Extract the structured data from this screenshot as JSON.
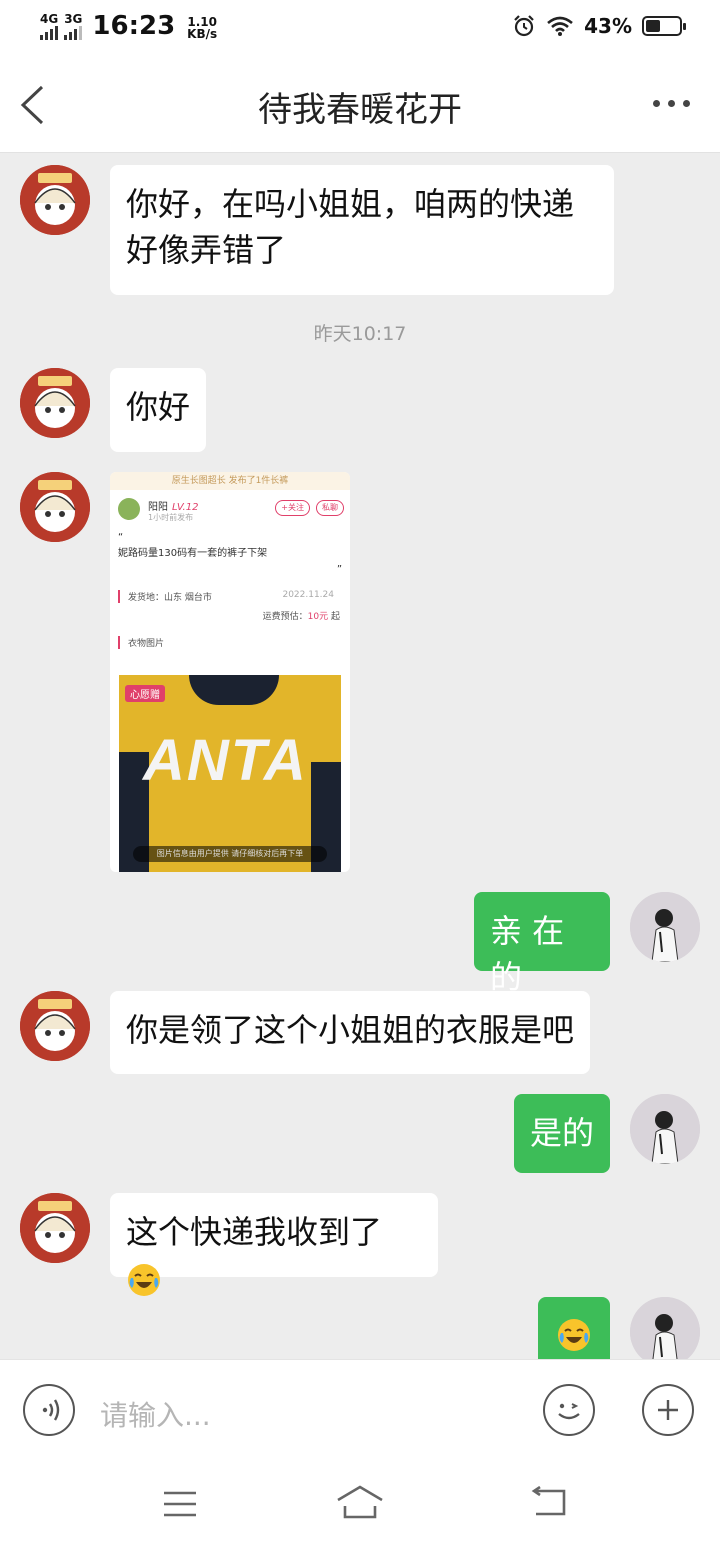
{
  "status_bar": {
    "network1": "4G",
    "network2": "3G",
    "time": "16:23",
    "speed_value": "1.10",
    "speed_unit": "KB/s",
    "battery": "43%",
    "battery_fraction": 0.43
  },
  "header": {
    "title": "待我春暖花开"
  },
  "messages": [
    {
      "sender": "other",
      "text_line1": "你好，在吗小姐姐，咱两的快递",
      "text_line2": "好像弄错了"
    },
    {
      "type": "timestamp",
      "text": "昨天10:17"
    },
    {
      "sender": "other",
      "text": "你好"
    },
    {
      "sender": "other",
      "type": "image"
    },
    {
      "sender": "me",
      "text": "亲 在的"
    },
    {
      "sender": "other",
      "text": "你是领了这个小姐姐的衣服是吧"
    },
    {
      "sender": "me",
      "text": "是的"
    },
    {
      "sender": "other",
      "text": "这个快递我收到了",
      "emoji": "crying-laughing-emoji"
    },
    {
      "sender": "me",
      "emoji": "crying-laughing-emoji"
    }
  ],
  "shared_image": {
    "top_note": "原生长图超长 发布了1件长裤",
    "user_name": "阳阳",
    "user_level": "LV.12",
    "post_time": "1小时前发布",
    "follow_label": "+关注",
    "private_msg_label": "私聊",
    "quote_text": "妮路码量130码有一套的裤子下架",
    "ship_from_label": "发货地：山东 烟台市",
    "ship_date": "2022.11.24",
    "fee_label": "运费预估：",
    "fee_value": "10元",
    "fee_suffix": "起",
    "photos_label": "衣物图片",
    "photo_tag": "心愿赠",
    "photo_brand": "ANTA",
    "photo_caption": "图片信息由用户提供 请仔细核对后再下单"
  },
  "input": {
    "placeholder": "请输入..."
  },
  "colors": {
    "my_bubble": "#3dbd58",
    "their_bubble": "#ffffff",
    "background": "#ededed"
  }
}
